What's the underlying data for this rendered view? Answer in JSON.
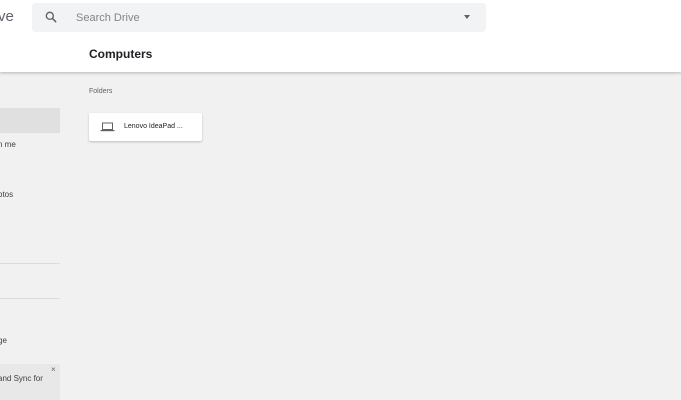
{
  "header": {
    "app_title": "ve",
    "search": {
      "placeholder": "Search Drive",
      "value": "",
      "search_icon": "search-icon",
      "options_icon": "caret-down-icon"
    },
    "page_title": "Computers"
  },
  "sidebar": {
    "items": [
      {
        "label": "n me"
      },
      {
        "label": "otos"
      },
      {
        "label": "ge"
      }
    ],
    "promo": {
      "text": "and Sync for",
      "close_label": "×"
    }
  },
  "main": {
    "section_label": "Folders",
    "folders": [
      {
        "name": "Lenovo IdeaPad ...",
        "icon": "laptop-icon"
      }
    ]
  },
  "colors": {
    "background": "#f1f1f1",
    "header": "#ffffff",
    "search_bg": "#f1f3f4",
    "selected_nav": "#e0e0e0"
  }
}
